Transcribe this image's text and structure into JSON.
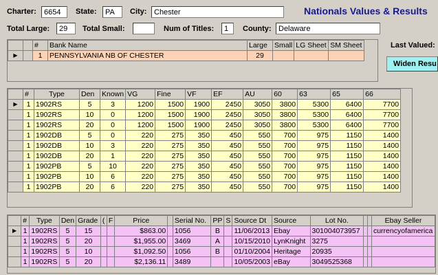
{
  "header": {
    "charter_label": "Charter:",
    "charter": "6654",
    "state_label": "State:",
    "state": "PA",
    "city_label": "City:",
    "city": "Chester",
    "title": "Nationals Values & Results",
    "total_large_label": "Total Large:",
    "total_large": "29",
    "total_small_label": "Total Small:",
    "total_small": "",
    "num_titles_label": "Num of Titles:",
    "num_titles": "1",
    "county_label": "County:",
    "county": "Delaware",
    "last_valued_label": "Last Valued:",
    "widen_button": "Widen Resu"
  },
  "bank_grid": {
    "headers": [
      "#",
      "Bank Name",
      "Large",
      "Small",
      "LG Sheet",
      "SM Sheet"
    ],
    "rows": [
      [
        "1",
        "PENNSYLVANIA NB OF CHESTER",
        "29",
        "",
        "",
        ""
      ]
    ]
  },
  "values_grid": {
    "headers": [
      "#",
      "Type",
      "Den",
      "Known",
      "VG",
      "Fine",
      "VF",
      "EF",
      "AU",
      "60",
      "63",
      "65",
      "66"
    ],
    "rows": [
      [
        "1",
        "1902RS",
        "5",
        "3",
        "1200",
        "1500",
        "1900",
        "2450",
        "3050",
        "3800",
        "5300",
        "6400",
        "7700"
      ],
      [
        "1",
        "1902RS",
        "10",
        "0",
        "1200",
        "1500",
        "1900",
        "2450",
        "3050",
        "3800",
        "5300",
        "6400",
        "7700"
      ],
      [
        "1",
        "1902RS",
        "20",
        "0",
        "1200",
        "1500",
        "1900",
        "2450",
        "3050",
        "3800",
        "5300",
        "6400",
        "7700"
      ],
      [
        "1",
        "1902DB",
        "5",
        "0",
        "220",
        "275",
        "350",
        "450",
        "550",
        "700",
        "975",
        "1150",
        "1400"
      ],
      [
        "1",
        "1902DB",
        "10",
        "3",
        "220",
        "275",
        "350",
        "450",
        "550",
        "700",
        "975",
        "1150",
        "1400"
      ],
      [
        "1",
        "1902DB",
        "20",
        "1",
        "220",
        "275",
        "350",
        "450",
        "550",
        "700",
        "975",
        "1150",
        "1400"
      ],
      [
        "1",
        "1902PB",
        "5",
        "10",
        "220",
        "275",
        "350",
        "450",
        "550",
        "700",
        "975",
        "1150",
        "1400"
      ],
      [
        "1",
        "1902PB",
        "10",
        "6",
        "220",
        "275",
        "350",
        "450",
        "550",
        "700",
        "975",
        "1150",
        "1400"
      ],
      [
        "1",
        "1902PB",
        "20",
        "6",
        "220",
        "275",
        "350",
        "450",
        "550",
        "700",
        "975",
        "1150",
        "1400"
      ]
    ]
  },
  "sales_grid": {
    "headers": [
      "#",
      "Type",
      "Den",
      "Grade",
      "(",
      "F",
      "Price",
      "",
      "Serial No.",
      "PP",
      "S",
      "Source Dt",
      "Source",
      "Lot No.",
      "",
      "",
      "Ebay Seller"
    ],
    "rows": [
      [
        "1",
        "1902RS",
        "5",
        "15",
        "",
        "",
        "$863.00",
        "",
        "1056",
        "B",
        "",
        "11/06/2013",
        "Ebay",
        "301004073957",
        "",
        "",
        "currencyofamerica"
      ],
      [
        "1",
        "1902RS",
        "5",
        "20",
        "",
        "",
        "$1,955.00",
        "",
        "3469",
        "A",
        "",
        "10/15/2010",
        "LynKnight",
        "3275",
        "",
        "",
        ""
      ],
      [
        "1",
        "1902RS",
        "5",
        "10",
        "",
        "",
        "$1,092.50",
        "",
        "1056",
        "B",
        "",
        "01/10/2004",
        "Heritage",
        "20935",
        "",
        "",
        ""
      ],
      [
        "1",
        "1902RS",
        "5",
        "20",
        "",
        "",
        "$2,136.11",
        "",
        "3489",
        "",
        "",
        "10/05/2003",
        "eBay",
        "3049525368",
        "",
        "",
        ""
      ]
    ]
  }
}
